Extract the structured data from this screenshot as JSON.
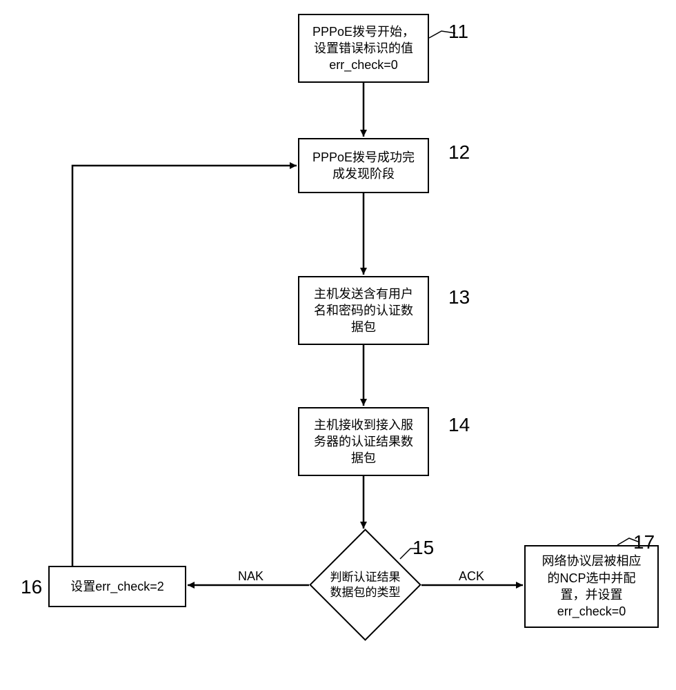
{
  "chart_data": {
    "type": "flowchart",
    "nodes": [
      {
        "id": 11,
        "text": "PPPoE拨号开始，\n设置错误标识的值\nerr_check=0",
        "shape": "rect"
      },
      {
        "id": 12,
        "text": "PPPoE拨号成功完\n成发现阶段",
        "shape": "rect"
      },
      {
        "id": 13,
        "text": "主机发送含有用户\n名和密码的认证数\n据包",
        "shape": "rect"
      },
      {
        "id": 14,
        "text": "主机接收到接入服\n务器的认证结果数\n据包",
        "shape": "rect"
      },
      {
        "id": 15,
        "text": "判断认证结果\n数据包的类型",
        "shape": "diamond"
      },
      {
        "id": 16,
        "text": "设置err_check=2",
        "shape": "rect"
      },
      {
        "id": 17,
        "text": "网络协议层被相应\n的NCP选中并配\n置，并设置\nerr_check=0",
        "shape": "rect"
      }
    ],
    "edges": [
      {
        "from": 11,
        "to": 12,
        "label": ""
      },
      {
        "from": 12,
        "to": 13,
        "label": ""
      },
      {
        "from": 13,
        "to": 14,
        "label": ""
      },
      {
        "from": 14,
        "to": 15,
        "label": ""
      },
      {
        "from": 15,
        "to": 16,
        "label": "NAK"
      },
      {
        "from": 15,
        "to": 17,
        "label": "ACK"
      },
      {
        "from": 16,
        "to": 12,
        "label": ""
      }
    ],
    "edge_labels": {
      "nak": "NAK",
      "ack": "ACK"
    }
  },
  "labels": {
    "n11": "11",
    "n12": "12",
    "n13": "13",
    "n14": "14",
    "n15": "15",
    "n16": "16",
    "n17": "17"
  },
  "node_text": {
    "n11": "PPPoE拨号开始，\n设置错误标识的值\nerr_check=0",
    "n12": "PPPoE拨号成功完\n成发现阶段",
    "n13": "主机发送含有用户\n名和密码的认证数\n据包",
    "n14": "主机接收到接入服\n务器的认证结果数\n据包",
    "n15": "判断认证结果\n数据包的类型",
    "n16": "设置err_check=2",
    "n17": "网络协议层被相应\n的NCP选中并配\n置，并设置\nerr_check=0"
  }
}
